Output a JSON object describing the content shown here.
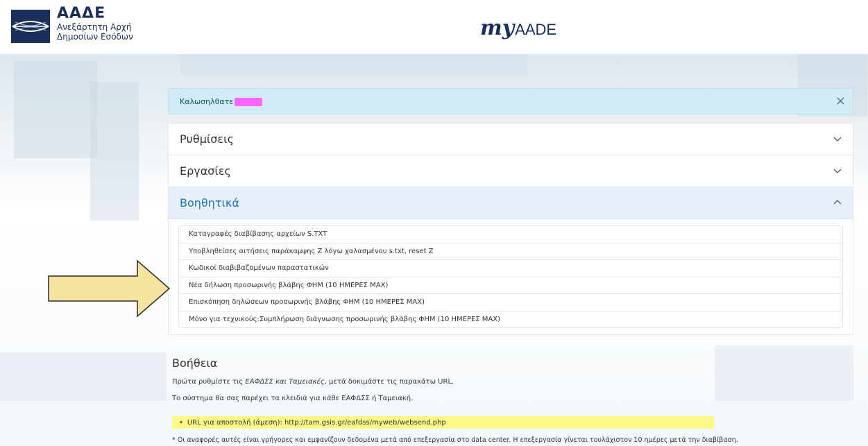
{
  "header": {
    "logo_abbr": "ΑΑΔΕ",
    "logo_line1": "Ανεξάρτητη Αρχή",
    "logo_line2": "Δημοσίων Εσόδων",
    "brand_my": "my",
    "brand_aade": "AADE"
  },
  "alert": {
    "text": "Καλωσηλθατε",
    "close_icon": "×"
  },
  "accordion": {
    "items": [
      {
        "label": "Ρυθμίσεις",
        "icon": "chevron-down-icon",
        "expanded": false
      },
      {
        "label": "Εργασίες",
        "icon": "chevron-down-icon",
        "expanded": false
      },
      {
        "label": "Βοηθητικά",
        "icon": "chevron-up-icon",
        "expanded": true
      }
    ],
    "links": [
      "Καταγραφές διαβίβασης αρχείων S.TXT",
      "Υποβληθείσες αιτήσεις παράκαμψης Ζ λόγω χαλασμένου s.txt, reset Z",
      "Κωδικοί διαβιβαζομένων παραστατικών",
      "Νέα δήλωση προσωρινής βλάβης ΦΗΜ (10 ΗΜΕΡΕΣ ΜΑΧ)",
      "Επισκόπηση δηλώσεων προσωρινής βλάβης ΦΗΜ (10 ΗΜΕΡΕΣ ΜΑΧ)",
      "Μόνο για τεχνικούς:Συμπλήρωση διάγνωσης προσωρινής βλάβης ΦΗΜ (10 ΗΜΕΡΕΣ ΜΑΧ)"
    ]
  },
  "help": {
    "title": "Βοήθεια",
    "p1_start": "Πρώτα ρυθμίστε τις ",
    "p1_em": "ΕΑΦΔΣΣ και Ταμειακές",
    "p1_end": ", μετά δοκιμάστε τις παρακάτω URL.",
    "p2": "Το σύστημα θα σας παρέχει τα κλειδιά για κάθε ΕΑΦΔΣΣ ή Ταμειακή.",
    "url_label": "URL για αποστολή (άμεση): http://tam.gsis.gr/eafdss/myweb/websend.php",
    "footnote": "* Οι αναφορές αυτές είναι γρήγορες και εμφανίζουν δεδομένα μετά από επεξεργασία στο data center. Η επεξεργασία γίνεται τουλάχιστον 10 ημέρες μετά την διαβίβαση."
  },
  "colors": {
    "brand_navy": "#1a2f5a",
    "alert_bg": "#d1ecf4",
    "active_header_text": "#1a73b5",
    "highlight": "#fbfa88",
    "arrow_fill": "#f7e3a0",
    "redaction": "#ff66ff"
  }
}
